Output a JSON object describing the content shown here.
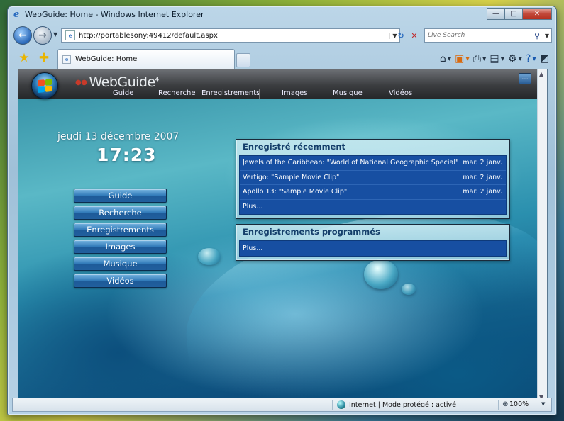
{
  "window": {
    "title": "WebGuide: Home - Windows Internet Explorer",
    "minimize_glyph": "—",
    "maximize_glyph": "□",
    "close_glyph": "✕"
  },
  "address_bar": {
    "url": "http://portablesony:49412/default.aspx",
    "search_placeholder": "Live Search"
  },
  "tab": {
    "label": "WebGuide: Home"
  },
  "webguide": {
    "logo_text": "WebGuide",
    "logo_version": "4",
    "more_label": "...",
    "nav": [
      "Guide",
      "Recherche",
      "Enregistrements",
      "Images",
      "Musique",
      "Vidéos"
    ]
  },
  "clock": {
    "date": "jeudi 13 décembre 2007",
    "time": "17:23"
  },
  "menu": [
    "Guide",
    "Recherche",
    "Enregistrements",
    "Images",
    "Musique",
    "Vidéos"
  ],
  "recent": {
    "title": "Enregistré récemment",
    "items": [
      {
        "title": "Jewels of the Caribbean: \"World of National Geographic Special\"",
        "date": "mar. 2 janv."
      },
      {
        "title": "Vertigo: \"Sample Movie Clip\"",
        "date": "mar. 2 janv."
      },
      {
        "title": "Apollo 13: \"Sample Movie Clip\"",
        "date": "mar. 2 janv."
      }
    ],
    "more": "Plus..."
  },
  "scheduled": {
    "title": "Enregistrements programmés",
    "more": "Plus..."
  },
  "status_bar": {
    "zone": "Internet | Mode protégé : activé",
    "zoom": "100%"
  },
  "colors": {
    "list_blue": "#174fa2",
    "panel_title": "#143e6a",
    "header_dark": "#3b3d40",
    "ie_close_red": "#c2483a"
  }
}
